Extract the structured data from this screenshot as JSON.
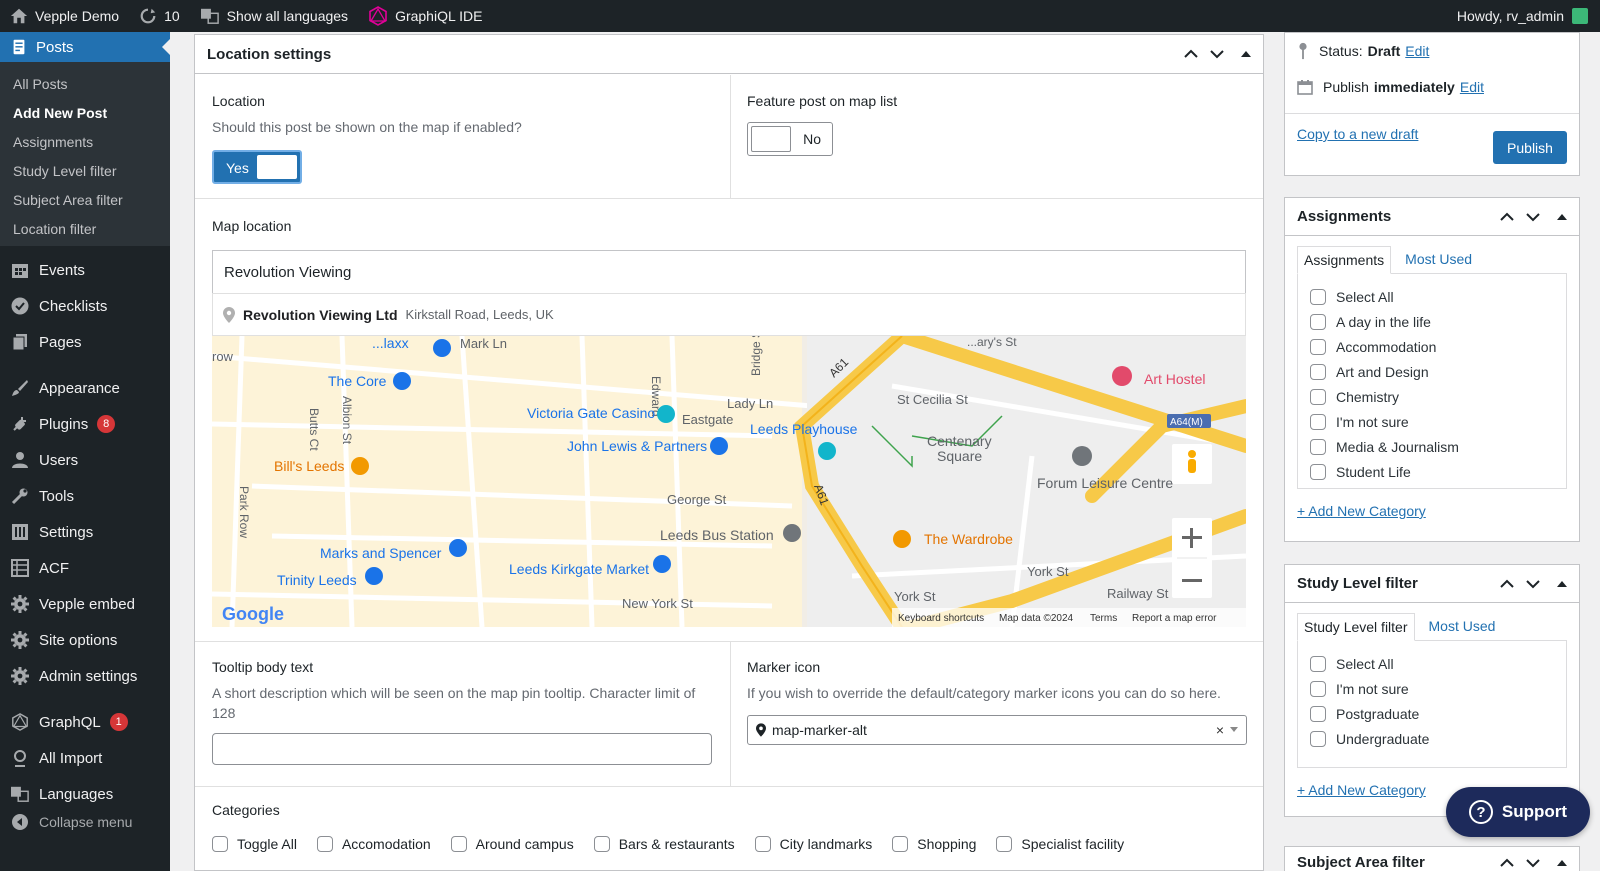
{
  "adminbar": {
    "site": "Vepple Demo",
    "updates": "10",
    "languages": "Show all languages",
    "graphiql": "GraphiQL IDE",
    "howdy": "Howdy, rv_admin"
  },
  "sidebar": {
    "posts": "Posts",
    "submenu": [
      "All Posts",
      "Add New Post",
      "Assignments",
      "Study Level filter",
      "Subject Area filter",
      "Location filter"
    ],
    "menu": [
      {
        "label": "Events",
        "icon": "calendar-icon"
      },
      {
        "label": "Checklists",
        "icon": "check-circle-icon"
      },
      {
        "label": "Pages",
        "icon": "pages-icon"
      },
      {
        "label": "Appearance",
        "icon": "brush-icon"
      },
      {
        "label": "Plugins",
        "icon": "plug-icon",
        "badge": "8"
      },
      {
        "label": "Users",
        "icon": "user-icon"
      },
      {
        "label": "Tools",
        "icon": "wrench-icon"
      },
      {
        "label": "Settings",
        "icon": "sliders-icon"
      },
      {
        "label": "ACF",
        "icon": "grid-icon"
      },
      {
        "label": "Vepple embed",
        "icon": "gear-icon"
      },
      {
        "label": "Site options",
        "icon": "gear-icon"
      },
      {
        "label": "Admin settings",
        "icon": "gear-icon"
      },
      {
        "label": "GraphQL",
        "icon": "graphql-icon",
        "badge": "1"
      },
      {
        "label": "All Import",
        "icon": "import-icon"
      },
      {
        "label": "Languages",
        "icon": "translate-icon"
      }
    ],
    "collapse": "Collapse menu"
  },
  "location_box": {
    "title": "Location settings",
    "location_label": "Location",
    "location_desc": "Should this post be shown on the map if enabled?",
    "location_toggle": "Yes",
    "feature_label": "Feature post on map list",
    "feature_toggle": "No",
    "map_label": "Map location",
    "map_search_value": "Revolution Viewing",
    "suggestion_name": "Revolution Viewing Ltd",
    "suggestion_addr": "Kirkstall Road, Leeds, UK",
    "map_places": {
      "the_core": "The Core",
      "victoria_gate": "Victoria Gate Casino",
      "john_lewis": "John Lewis & Partners",
      "leeds_playhouse": "Leeds Playhouse",
      "centenary": "Centenary",
      "square": "Square",
      "forum": "Forum Leisure Centre",
      "art_hostel": "Art Hostel",
      "bills": "Bill's Leeds",
      "bus_station": "Leeds Bus Station",
      "wardrobe": "The Wardrobe",
      "marks": "Marks and Spencer",
      "trinity": "Trinity Leeds",
      "kirkgate": "Leeds Kirkgate Market",
      "maxx": "...laxx",
      "mark_ln": "Mark Ln",
      "eastgate": "Eastgate",
      "lady_ln": "Lady Ln",
      "st_cecilia": "St Cecilia St",
      "george_st": "George St",
      "york_st": "York St",
      "york_st2": "York St",
      "railway_st": "Railway St",
      "new_york_st": "New York St",
      "a61": "A61",
      "a61b": "A61",
      "a64m": "A64(M)",
      "park_row": "Park Row",
      "butts_ct": "Butts Ct",
      "albion_st": "Albion St",
      "edward": "Edward",
      "bridge_st": "Bridge St",
      "marys_st": "...ary's St",
      "row": "row"
    },
    "map_footer": {
      "shortcuts": "Keyboard shortcuts",
      "data": "Map data ©2024",
      "terms": "Terms",
      "report": "Report a map error",
      "google": "Google"
    },
    "tooltip_label": "Tooltip body text",
    "tooltip_desc": "A short description which will be seen on the map pin tooltip. Character limit of 128",
    "tooltip_value": "",
    "marker_label": "Marker icon",
    "marker_desc": "If you wish to override the default/category marker icons you can do so here.",
    "marker_value": "map-marker-alt",
    "categories_label": "Categories",
    "categories": [
      "Toggle All",
      "Accomodation",
      "Around campus",
      "Bars & restaurants",
      "City landmarks",
      "Shopping",
      "Specialist facility"
    ]
  },
  "publish": {
    "status_label": "Status:",
    "status_value": "Draft",
    "edit": "Edit",
    "publish_label": "Publish",
    "publish_when": "immediately",
    "copy_draft": "Copy to a new draft",
    "publish_button": "Publish"
  },
  "assignments": {
    "title": "Assignments",
    "tab_all": "Assignments",
    "tab_used": "Most Used",
    "items": [
      "Select All",
      "A day in the life",
      "Accommodation",
      "Art and Design",
      "Chemistry",
      "I'm not sure",
      "Media & Journalism",
      "Student Life"
    ],
    "add": "+ Add New Category"
  },
  "study_level": {
    "title": "Study Level filter",
    "tab_all": "Study Level filter",
    "tab_used": "Most Used",
    "items": [
      "Select All",
      "I'm not sure",
      "Postgraduate",
      "Undergraduate"
    ],
    "add": "+ Add New Category"
  },
  "subject_area": {
    "title": "Subject Area filter"
  },
  "support": {
    "label": "Support"
  },
  "colors": {
    "wp_blue": "#2271b1",
    "admin_dark": "#1d2327",
    "badge_red": "#d63638"
  }
}
